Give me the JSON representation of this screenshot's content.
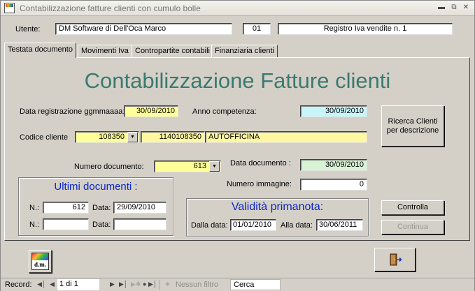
{
  "window": {
    "title": "Contabilizzazione fatture clienti con cumulo bolle"
  },
  "header": {
    "utente_label": "Utente:",
    "utente_value": "DM Software di Dell'Oca Marco",
    "code_value": "01",
    "registro_value": "Registro Iva vendite n. 1"
  },
  "tabs": [
    {
      "label": "Testata documento",
      "active": true
    },
    {
      "label": "Movimenti Iva",
      "active": false
    },
    {
      "label": "Contropartite contabili",
      "active": false
    },
    {
      "label": "Finanziaria clienti",
      "active": false
    }
  ],
  "form": {
    "title": "Contabilizzazione Fatture clienti",
    "data_registrazione_label": "Data registrazione ggmmaaaa:",
    "data_registrazione_value": "30/09/2010",
    "anno_competenza_label": "Anno competenza:",
    "anno_competenza_value": "30/09/2010",
    "ricerca_button": "Ricerca Clienti per descrizione",
    "codice_cliente_label": "Codice cliente",
    "codice_cliente_value": "108350",
    "conto_value": "1140108350",
    "ragione_sociale_value": "AUTOFFICINA",
    "numero_documento_label": "Numero documento:",
    "numero_documento_value": "613",
    "data_documento_label": "Data documento :",
    "data_documento_value": "30/09/2010",
    "numero_immagine_label": "Numero immagine:",
    "numero_immagine_value": "0"
  },
  "ultimi_documenti": {
    "title": "Ultimi documenti :",
    "row1_n_label": "N.:",
    "row1_n_value": "612",
    "row1_data_label": "Data:",
    "row1_data_value": "29/09/2010",
    "row2_n_label": "N.:",
    "row2_n_value": "",
    "row2_data_label": "Data:",
    "row2_data_value": ""
  },
  "validita": {
    "title": "Validità primanota:",
    "dalla_label": "Dalla data:",
    "dalla_value": "01/01/2010",
    "alla_label": "Alla data:",
    "alla_value": "30/06/2011"
  },
  "buttons": {
    "controlla": "Controlla",
    "continua": "Continua",
    "logo": "d.m."
  },
  "recordbar": {
    "record_label": "Record:",
    "position": "1 di 1",
    "filter_label": "Nessun filtro",
    "search_label": "Cerca"
  },
  "icons": {
    "first": "first-record-icon",
    "prev": "prev-record-icon",
    "next": "next-record-icon",
    "last": "last-record-icon",
    "new": "new-record-icon",
    "filter": "filter-icon",
    "exit": "exit-door-icon"
  }
}
